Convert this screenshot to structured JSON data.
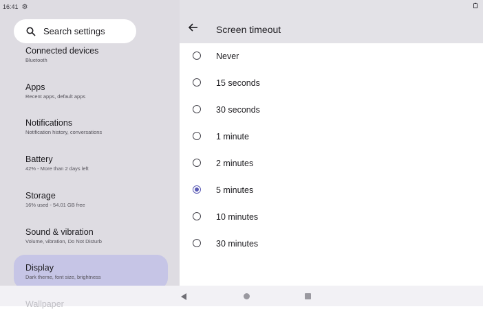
{
  "status_bar": {
    "time": "16:41"
  },
  "search": {
    "placeholder": "Search settings"
  },
  "sidebar": {
    "items": [
      {
        "title": "Connected devices",
        "subtitle": "Bluetooth"
      },
      {
        "title": "Apps",
        "subtitle": "Recent apps, default apps"
      },
      {
        "title": "Notifications",
        "subtitle": "Notification history, conversations"
      },
      {
        "title": "Battery",
        "subtitle": "42% - More than 2 days left"
      },
      {
        "title": "Storage",
        "subtitle": "16% used - 54.01 GB free"
      },
      {
        "title": "Sound & vibration",
        "subtitle": "Volume, vibration, Do Not Disturb"
      },
      {
        "title": "Display",
        "subtitle": "Dark theme, font size, brightness",
        "selected": true
      },
      {
        "title": "Wallpaper",
        "subtitle": ""
      }
    ]
  },
  "detail": {
    "title": "Screen timeout",
    "options": [
      "Never",
      "15 seconds",
      "30 seconds",
      "1 minute",
      "2 minutes",
      "5 minutes",
      "10 minutes",
      "30 minutes"
    ],
    "selected": "5 minutes"
  },
  "colors": {
    "accent": "#5b5bb5",
    "selected_bg": "#c6c5e6",
    "sidebar_bg": "#dedce2"
  },
  "icons": [
    "settings-gear-icon",
    "search-icon",
    "back-arrow-icon",
    "battery-icon",
    "nav-back-icon",
    "nav-home-icon",
    "nav-recents-icon"
  ]
}
